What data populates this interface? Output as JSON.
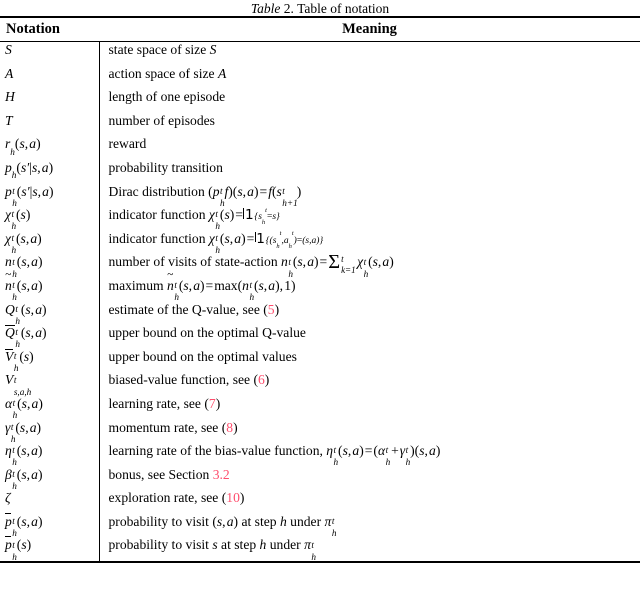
{
  "caption": {
    "label_italic": "Table",
    "number": "2.",
    "text": "Table of notation"
  },
  "table": {
    "columns": [
      {
        "key": "notation",
        "header": "Notation"
      },
      {
        "key": "meaning",
        "header": "Meaning"
      }
    ],
    "accent_reference_color": "#ff4d6d",
    "rows": [
      {
        "notation_text": "S",
        "meaning_text": "state space of size S",
        "reference": null
      },
      {
        "notation_text": "A",
        "meaning_text": "action space of size A",
        "reference": null
      },
      {
        "notation_text": "H",
        "meaning_text": "length of one episode",
        "reference": null
      },
      {
        "notation_text": "T",
        "meaning_text": "number of episodes",
        "reference": null
      },
      {
        "notation_text": "r_h(s,a)",
        "meaning_text": "reward",
        "reference": null
      },
      {
        "notation_text": "p_h(s'|s,a)",
        "meaning_text": "probability transition",
        "reference": null
      },
      {
        "notation_text": "p_h^t(s'|s,a)",
        "meaning_text": "Dirac distribution (p_h^t f)(s,a) = f(s_{h+1}^t)",
        "reference": null
      },
      {
        "notation_text": "chi_h^t(s)",
        "meaning_text": "indicator function chi_h^t(s) = 1_{s_h^t = s}",
        "reference": null
      },
      {
        "notation_text": "chi_h^t(s,a)",
        "meaning_text": "indicator function chi_h^t(s,a) = 1_{(s_h^t,a_h^t)=(s,a)}",
        "reference": null
      },
      {
        "notation_text": "n_h^t(s,a)",
        "meaning_text": "number of visits of state-action n_h^t(s,a) = sum_{k=1}^{t} chi_h^t(s,a)",
        "reference": null
      },
      {
        "notation_text": "tilde n_h^t(s,a)",
        "meaning_text": "maximum tilde n_h^t(s,a) = max(n_h^t(s,a), 1)",
        "reference": null
      },
      {
        "notation_text": "Q_h^t(s,a)",
        "meaning_text": "estimate of the Q-value, see (5)",
        "reference": "5"
      },
      {
        "notation_text": "overline Q_h^t(s,a)",
        "meaning_text": "upper bound on the optimal Q-value",
        "reference": null
      },
      {
        "notation_text": "overline V_h^t(s)",
        "meaning_text": "upper bound on the optimal values",
        "reference": null
      },
      {
        "notation_text": "V_{s,a,h}^t",
        "meaning_text": "biased-value function, see (6)",
        "reference": "6"
      },
      {
        "notation_text": "alpha_h^t(s,a)",
        "meaning_text": "learning rate, see (7)",
        "reference": "7"
      },
      {
        "notation_text": "gamma_h^t(s,a)",
        "meaning_text": "momentum rate, see (8)",
        "reference": "8"
      },
      {
        "notation_text": "eta_h^t(s,a)",
        "meaning_text": "learning rate of the bias-value function, eta_h^t(s,a) = (alpha_h^t + gamma_h^t)(s,a)",
        "reference": null
      },
      {
        "notation_text": "beta_h^t(s,a)",
        "meaning_text": "bonus, see Section 3.2",
        "reference": "3.2"
      },
      {
        "notation_text": "zeta",
        "meaning_text": "exploration rate, see (10)",
        "reference": "10"
      },
      {
        "notation_text": "bar p_h^t(s,a)",
        "meaning_text": "probability to visit (s,a) at step h under pi_h^t",
        "reference": null
      },
      {
        "notation_text": "bar p_h^t(s)",
        "meaning_text": "probability to visit s at step h under pi_h^t",
        "reference": null
      }
    ]
  }
}
